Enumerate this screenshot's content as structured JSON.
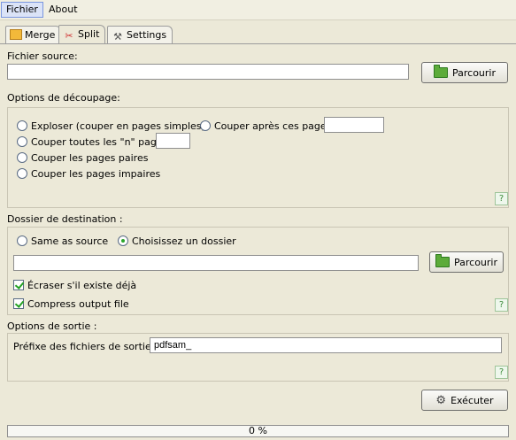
{
  "menu": {
    "items": [
      "Fichier",
      "About"
    ]
  },
  "tabs": [
    "Merge",
    "Split",
    "Settings"
  ],
  "source": {
    "label": "Fichier source:",
    "value": "",
    "browse_label": "Parcourir"
  },
  "split_options": {
    "label": "Options de découpage:",
    "explode": "Exploser (couper en pages simples)",
    "after_pages": "Couper après ces pages",
    "every_n": "Couper toutes les \"n\" pages",
    "even": "Couper les pages paires",
    "odd": "Couper les pages impaires"
  },
  "destination": {
    "label": "Dossier de destination :",
    "same_as_source": "Same as source",
    "choose_folder": "Choisissez un dossier",
    "value": "",
    "browse_label": "Parcourir",
    "overwrite": "Écraser s'il existe déjà",
    "compress": "Compress output file"
  },
  "output": {
    "label": "Options de sortie :",
    "prefix_label": "Préfixe des fichiers de sortie:",
    "prefix_value": "pdfsam_"
  },
  "run_label": "Exécuter",
  "progress": {
    "percent": 0,
    "text": "0 %"
  },
  "icons": {
    "help": "help-icon",
    "folder": "folder-icon",
    "run": "gear-icon"
  }
}
